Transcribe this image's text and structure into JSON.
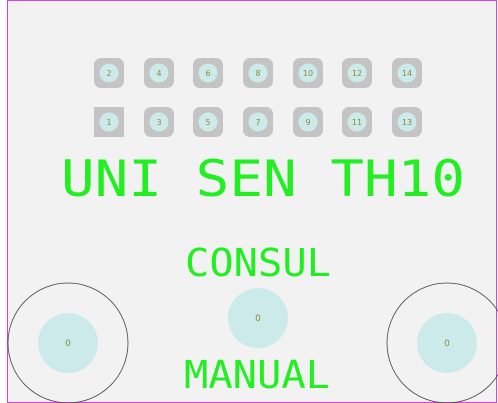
{
  "colors": {
    "board_fill": "#f2f2f2",
    "outline": "#e040e0",
    "pad_square": "#c4c4c4",
    "pad_dot": "#cdeaea",
    "pad_label": "#8a8a3a",
    "silkscreen": "#22ee22",
    "hole_outline": "#444444"
  },
  "header": {
    "top_row": [
      "2",
      "4",
      "6",
      "8",
      "10",
      "12",
      "14"
    ],
    "bottom_row": [
      "1",
      "3",
      "5",
      "7",
      "9",
      "11",
      "13"
    ]
  },
  "silkscreen": {
    "title": "UNI SEN TH10",
    "subtitle": "CONSUL",
    "footer": "MANUAL"
  },
  "mounting_holes": {
    "left_label": "0",
    "center_label": "0",
    "right_label": "0"
  }
}
